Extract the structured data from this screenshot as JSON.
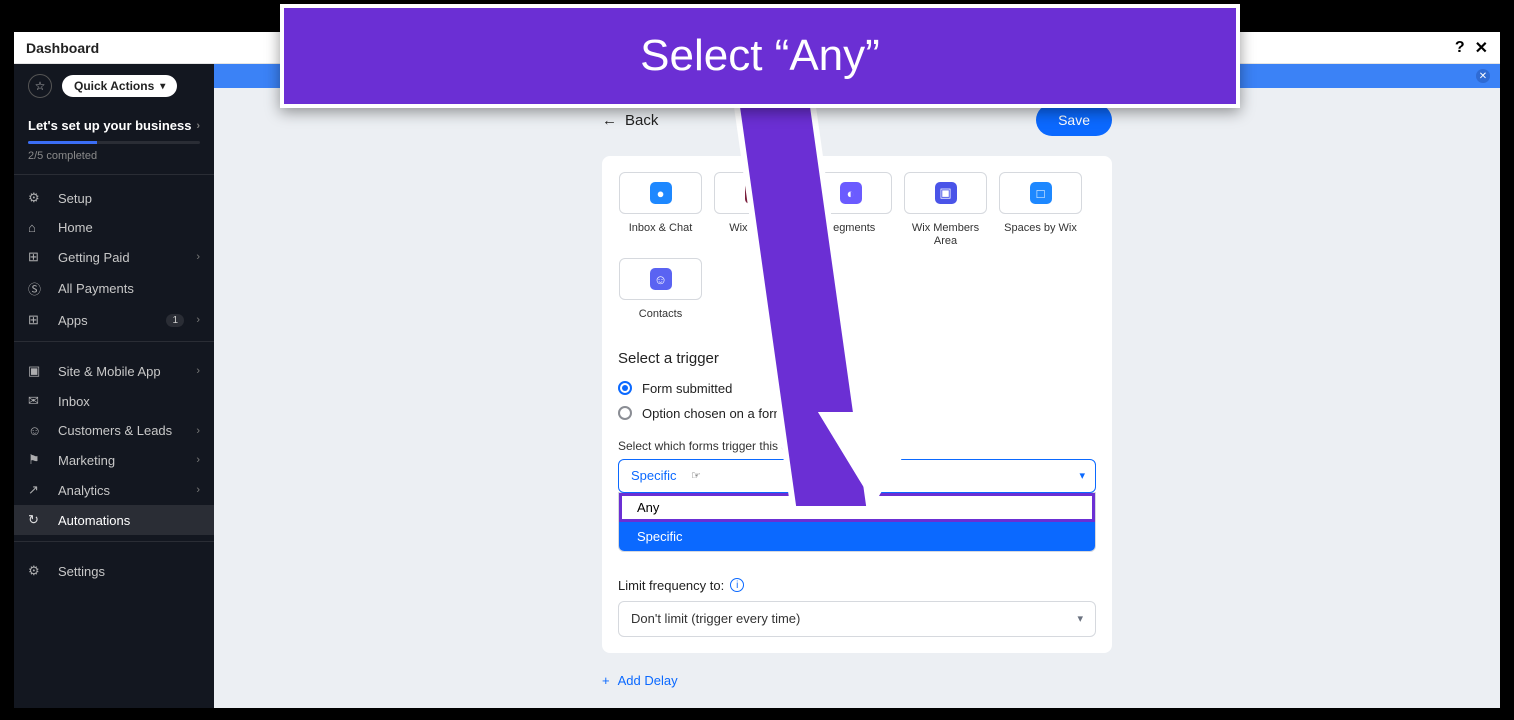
{
  "callout": {
    "text": "Select “Any”"
  },
  "titlebar": {
    "title": "Dashboard"
  },
  "sidebar": {
    "quick_actions": "Quick Actions",
    "setup_heading": "Let's set up your business",
    "progress_text": "2/5 completed",
    "items": [
      {
        "label": "Setup",
        "icon": "⚙",
        "chev": false
      },
      {
        "label": "Home",
        "icon": "⌂",
        "chev": false
      },
      {
        "label": "Getting Paid",
        "icon": "⊞",
        "chev": true
      },
      {
        "label": "All Payments",
        "icon": "Ⓢ",
        "chev": false
      },
      {
        "label": "Apps",
        "icon": "⊞",
        "chev": true,
        "badge": "1"
      }
    ],
    "items2": [
      {
        "label": "Site & Mobile App",
        "icon": "▣",
        "chev": true
      },
      {
        "label": "Inbox",
        "icon": "✉",
        "chev": false
      },
      {
        "label": "Customers & Leads",
        "icon": "☺",
        "chev": true
      },
      {
        "label": "Marketing",
        "icon": "⚑",
        "chev": true
      },
      {
        "label": "Analytics",
        "icon": "↗",
        "chev": true
      },
      {
        "label": "Automations",
        "icon": "↻",
        "chev": false,
        "active": true
      }
    ],
    "items3": [
      {
        "label": "Settings",
        "icon": "⚙",
        "chev": false
      }
    ]
  },
  "page": {
    "back_label": "Back",
    "save_label": "Save",
    "apps": [
      {
        "label": "Inbox & Chat",
        "color": "#1e88ff",
        "glyph": "●"
      },
      {
        "label": "Wix Forms",
        "color": "#7a1f3d",
        "glyph": "☰"
      },
      {
        "label": "Segments",
        "color": "#6b5bff",
        "glyph": "◐"
      },
      {
        "label": "Wix Members Area",
        "color": "#4a54e8",
        "glyph": "▣"
      },
      {
        "label": "Spaces by Wix",
        "color": "#1e88ff",
        "glyph": "□"
      },
      {
        "label": "Contacts",
        "color": "#5a63f2",
        "glyph": "☺"
      }
    ],
    "select_trigger_heading": "Select a trigger",
    "radio": {
      "option1": "Form submitted",
      "option2": "Option chosen on a form"
    },
    "forms_label": "Select which forms trigger this automation:",
    "forms_select_value": "Specific",
    "dropdown": {
      "opt_any": "Any",
      "opt_specific": "Specific"
    },
    "freq_label": "Limit frequency to:",
    "freq_value": "Don't limit (trigger every time)",
    "add_delay": "Add Delay"
  }
}
